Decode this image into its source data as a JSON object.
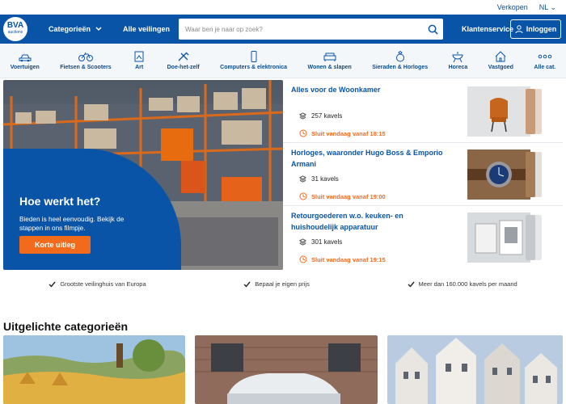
{
  "topbar": {
    "sell": "Verkopen",
    "lang": "NL"
  },
  "logo": {
    "main": "BVA",
    "sub": "auctions"
  },
  "header": {
    "categories": "Categorieën",
    "all_auctions": "Alle veilingen",
    "search_placeholder": "Waar ben je naar op zoek?",
    "customer_service": "Klantenservice",
    "login": "Inloggen"
  },
  "categories": [
    {
      "label": "Voertuigen",
      "icon": "car-icon"
    },
    {
      "label": "Fietsen & Scooters",
      "icon": "bicycle-icon"
    },
    {
      "label": "Art",
      "icon": "art-icon"
    },
    {
      "label": "Doe-het-zelf",
      "icon": "tools-icon"
    },
    {
      "label": "Computers & elektronica",
      "icon": "phone-icon"
    },
    {
      "label": "Wonen & slapen",
      "icon": "sofa-icon"
    },
    {
      "label": "Sieraden & Horloges",
      "icon": "ring-icon"
    },
    {
      "label": "Horeca",
      "icon": "bbq-icon"
    },
    {
      "label": "Vastgoed",
      "icon": "house-icon"
    },
    {
      "label": "Alle cat.",
      "icon": "dots-icon"
    }
  ],
  "hero": {
    "title": "Hoe werkt het?",
    "text": "Bieden is heel eenvoudig. Bekijk de stappen in ons filmpje.",
    "button": "Korte uitleg"
  },
  "auctions": [
    {
      "title": "Alles voor de Woonkamer",
      "count": "257 kavels",
      "closing": "Sluit vandaag vanaf 18:15",
      "thumb_color": "#cfd3d6"
    },
    {
      "title": "Horloges, waaronder Hugo Boss & Emporio Armani",
      "count": "31 kavels",
      "closing": "Sluit vandaag vanaf 19:00",
      "thumb_color": "#7b5a3e"
    },
    {
      "title": "Retourgoederen w.o. keuken- en huishoudelijk apparatuur",
      "count": "301 kavels",
      "closing": "Sluit vandaag vanaf 19:15",
      "thumb_color": "#c9ccd0"
    }
  ],
  "usps": [
    "Grootste veilinghuis van Europa",
    "Bepaal je eigen prijs",
    "Meer dan 160.000 kavels per maand"
  ],
  "featured_title": "Uitgelichte categorieën",
  "colors": {
    "brand": "#0a54a7",
    "accent": "#f26a1b"
  }
}
